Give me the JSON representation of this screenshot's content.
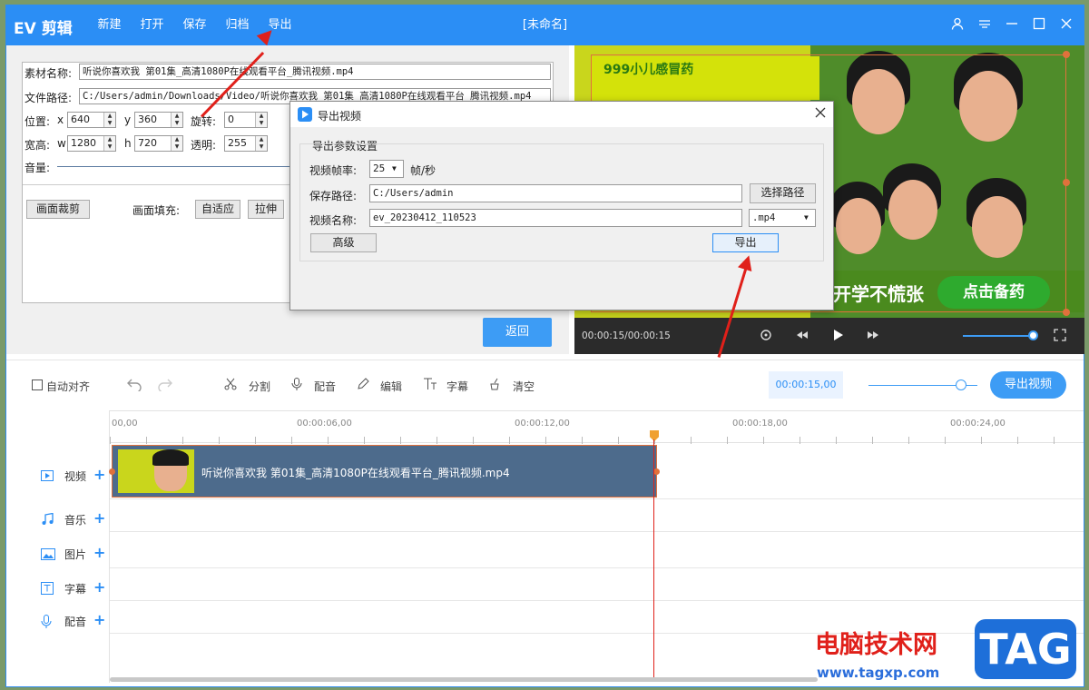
{
  "app": {
    "logo": "EV 剪辑",
    "menu": [
      "新建",
      "打开",
      "保存",
      "归档",
      "导出"
    ],
    "window_title": "[未命名]",
    "window_controls": [
      "user-icon",
      "menu-icon",
      "minimize-icon",
      "maximize-icon",
      "close-icon"
    ]
  },
  "properties": {
    "material_name_label": "素材名称:",
    "material_name": "听说你喜欢我 第01集_高清1080P在线观看平台_腾讯视频.mp4",
    "file_path_label": "文件路径:",
    "file_path": "C:/Users/admin/Downloads/Video/听说你喜欢我 第01集_高清1080P在线观看平台_腾讯视频.mp4",
    "position_label": "位置:",
    "x_label": "x",
    "x_value": "640",
    "y_label": "y",
    "y_value": "360",
    "rotate_label": "旋转:",
    "rotate_value": "0",
    "size_label": "宽高:",
    "w_label": "w",
    "w_value": "1280",
    "h_label": "h",
    "h_value": "720",
    "opacity_label": "透明:",
    "opacity_value": "255",
    "volume_label": "音量:",
    "crop_button": "画面裁剪",
    "fill_label": "画面填充:",
    "fill_adapt": "自适应",
    "fill_stretch": "拉伸",
    "return_button": "返回"
  },
  "preview": {
    "ad_brand": "999小儿感冒药",
    "ad_slogan": "开学不慌张",
    "ad_button": "点击备药",
    "time": "00:00:15/00:00:15"
  },
  "toolbar": {
    "auto_align": "自动对齐",
    "split": "分割",
    "dub": "配音",
    "edit": "编辑",
    "subtitle": "字幕",
    "clear": "清空",
    "time": "00:00:15,00",
    "export_video": "导出视频"
  },
  "ruler": [
    "00,00",
    "00:00:06,00",
    "00:00:12,00",
    "00:00:18,00",
    "00:00:24,00"
  ],
  "tracks": [
    "视频",
    "音乐",
    "图片",
    "字幕",
    "配音"
  ],
  "clip": {
    "name": "听说你喜欢我 第01集_高清1080P在线观看平台_腾讯视频.mp4"
  },
  "dialog": {
    "title": "导出视频",
    "group": "导出参数设置",
    "fps_label": "视频帧率:",
    "fps_value": "25",
    "fps_unit": "帧/秒",
    "save_path_label": "保存路径:",
    "save_path": "C:/Users/admin",
    "choose_path": "选择路径",
    "video_name_label": "视频名称:",
    "video_name": "ev_20230412_110523",
    "format": ".mp4",
    "advanced": "高级",
    "export": "导出"
  },
  "watermark": {
    "site_name": "电脑技术网",
    "url": "www.tagxp.com",
    "tag": "TAG"
  },
  "colors": {
    "accent": "#2b8ef5",
    "clip": "#4d6b8c",
    "playhead": "#e0201a"
  }
}
